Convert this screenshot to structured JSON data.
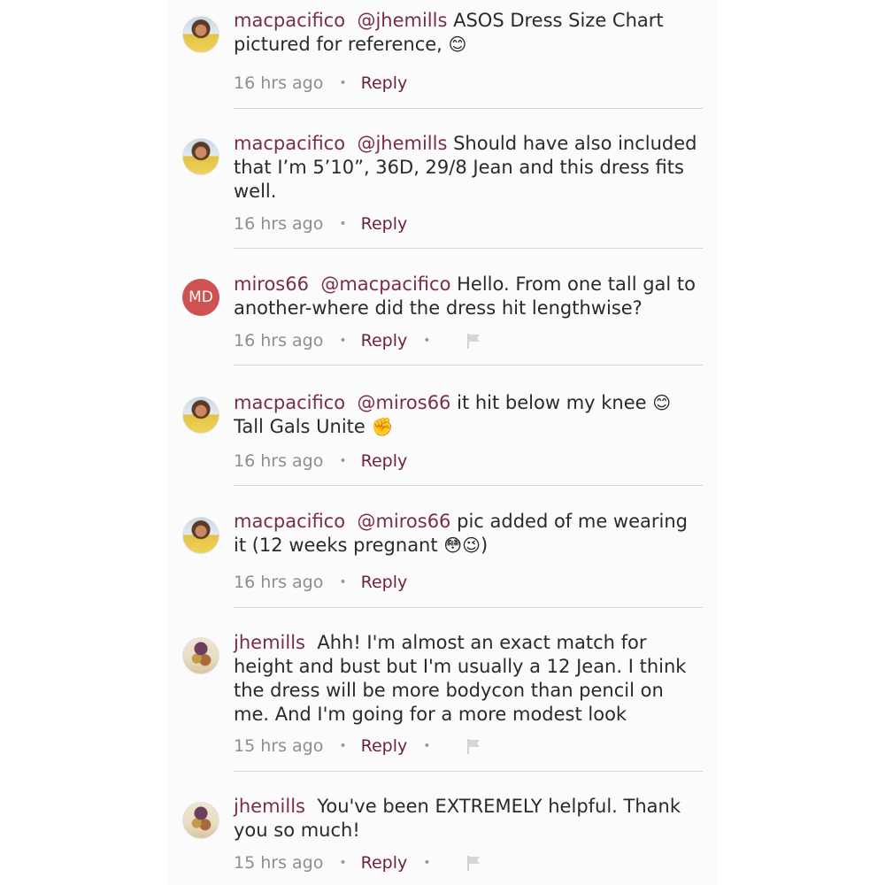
{
  "comments": [
    {
      "user": "macpacifico",
      "mention": "@jhemills",
      "text": "ASOS Dress Size Chart pictured for reference,",
      "emoji": "😊",
      "time": "16 hrs ago",
      "reply": "Reply",
      "avatar": "photo",
      "flag": false
    },
    {
      "user": "macpacifico",
      "mention": "@jhemills",
      "text": "Should have also included that I’m 5’10”, 36D, 29/8 Jean and this dress fits well.",
      "emoji": "",
      "time": "16 hrs ago",
      "reply": "Reply",
      "avatar": "photo",
      "flag": false
    },
    {
      "user": "miros66",
      "mention": "@macpacifico",
      "text": "Hello. From one tall gal to another-where did the dress hit lengthwise?",
      "emoji": "",
      "time": "16 hrs ago",
      "reply": "Reply",
      "avatar_initials": "MD",
      "flag": true
    },
    {
      "user": "macpacifico",
      "mention": "@miros66",
      "text": "it hit below my knee",
      "emoji": "😊",
      "text2": "Tall Gals Unite",
      "emoji2": "✊",
      "time": "16 hrs ago",
      "reply": "Reply",
      "avatar": "photo",
      "flag": false
    },
    {
      "user": "macpacifico",
      "mention": "@miros66",
      "text": "pic added of me wearing it (12 weeks pregnant",
      "emoji": "😳😉",
      "text2": ")",
      "time": "16 hrs ago",
      "reply": "Reply",
      "avatar": "photo",
      "flag": false
    },
    {
      "user": "jhemills",
      "mention": "",
      "text": "Ahh! I'm almost an exact match for height and bust but I'm usually a 12 Jean. I think the dress will be more bodycon than pencil on me. And I'm going for a more modest look",
      "emoji": "",
      "time": "15 hrs ago",
      "reply": "Reply",
      "avatar": "photo",
      "flag": true
    },
    {
      "user": "jhemills",
      "mention": "",
      "text": "You've been EXTREMELY helpful. Thank you so much!",
      "emoji": "",
      "time": "15 hrs ago",
      "reply": "Reply",
      "avatar": "photo",
      "flag": true
    }
  ],
  "colors": {
    "username": "#7a2e42",
    "reply": "#6e2336",
    "meta": "#8e8e8e",
    "initials_bg": "#cf5252"
  },
  "icons": {
    "flag": "flag-icon",
    "bullet": "dot-separator"
  }
}
